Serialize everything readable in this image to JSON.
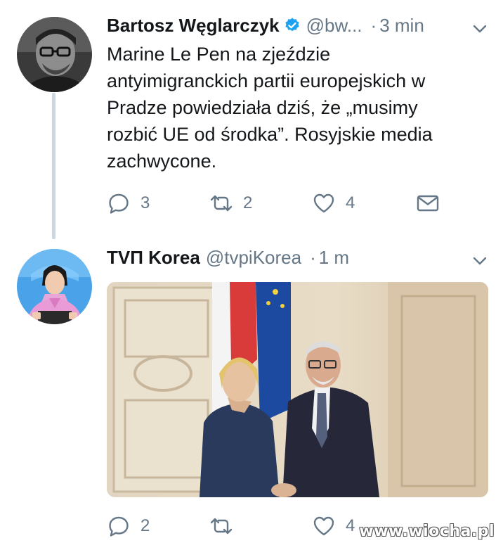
{
  "tweet1": {
    "name": "Bartosz Węglarczyk",
    "handle": "@bw...",
    "separator": "·",
    "time": "3 min",
    "text_lines": [
      "Marine Le Pen na zjeździe",
      "antyimigranckich partii europejskich w",
      "Pradze powiedziała dziś, że „musimy",
      "rozbić UE od środka”. Rosyjskie media",
      "zachwycone."
    ],
    "replies": "3",
    "retweets": "2",
    "likes": "4"
  },
  "tweet2": {
    "name": "ТVП Korea",
    "handle": "@tvpiKorea",
    "separator": "·",
    "time": "1 m",
    "replies": "2",
    "retweets": "",
    "likes": "4"
  },
  "watermark": "www.wiocha.pl",
  "colors": {
    "text": "#14171a",
    "secondary": "#657786",
    "verified": "#1da1f2",
    "thread_line": "#ccd6dd"
  }
}
